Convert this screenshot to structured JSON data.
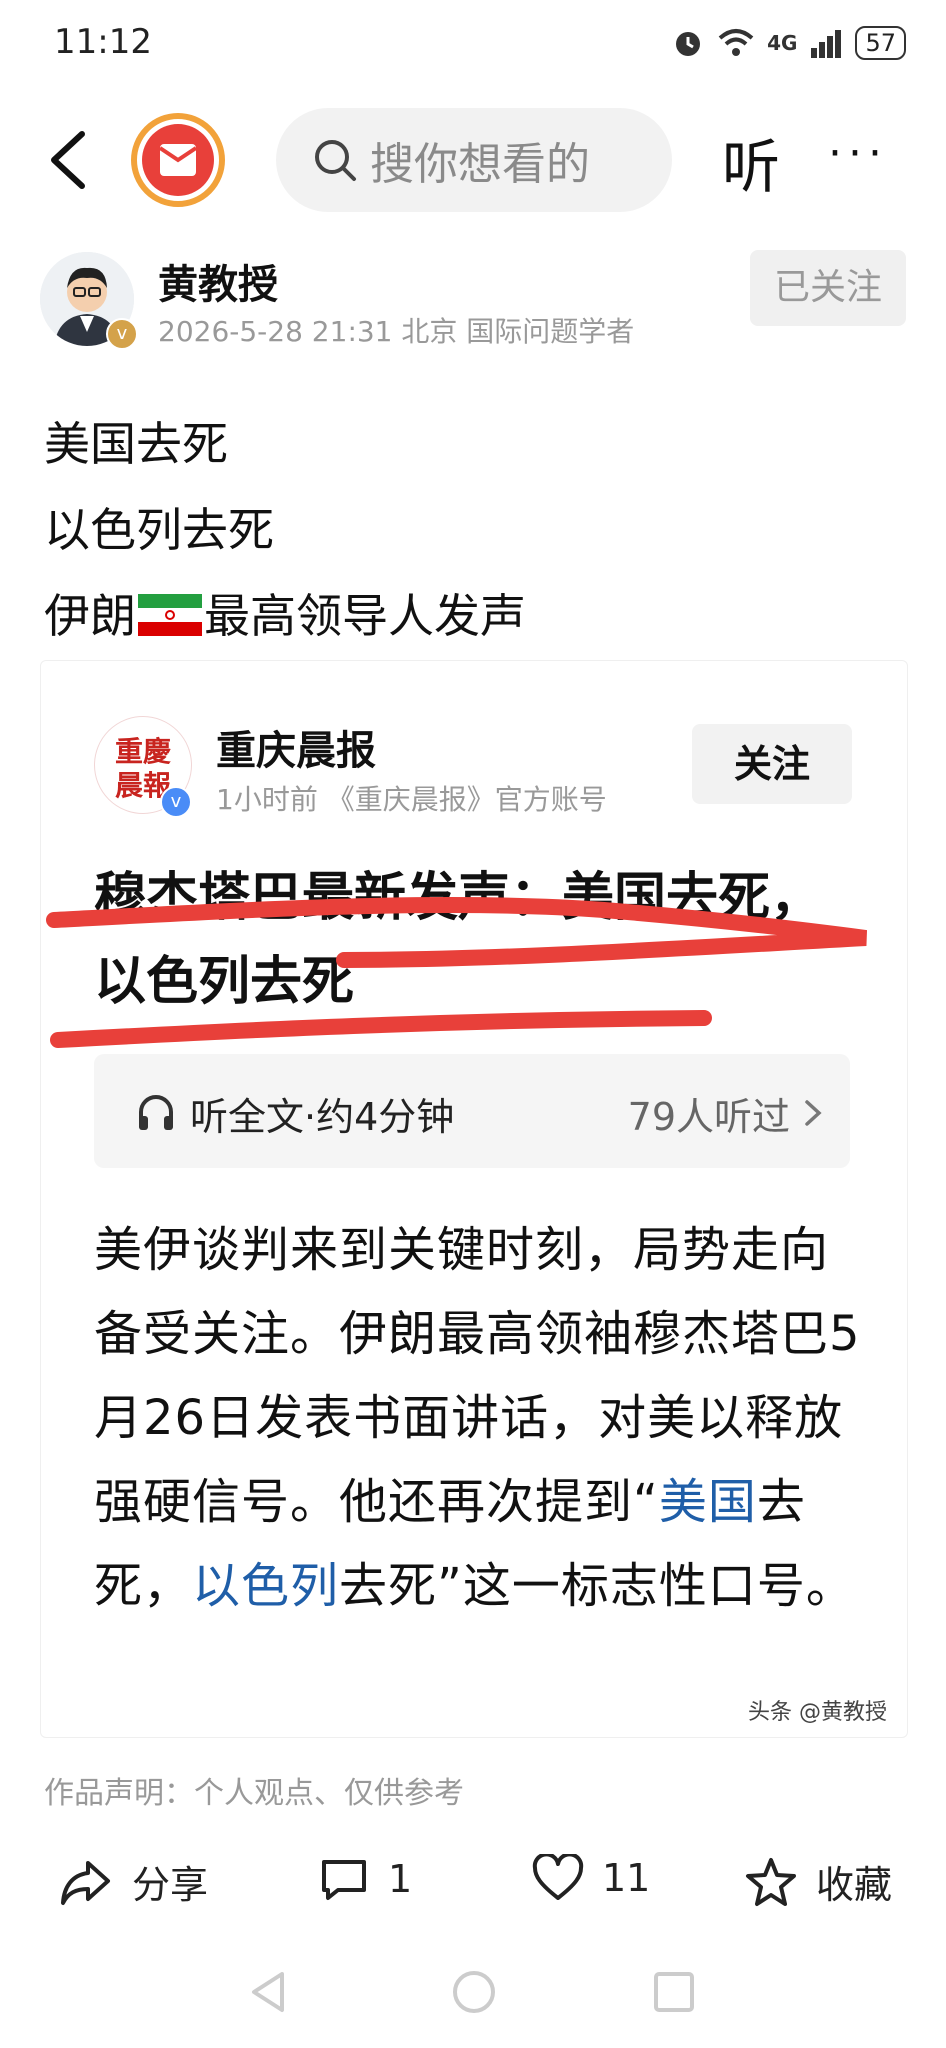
{
  "status_bar": {
    "time": "11:12",
    "network": "4G",
    "battery": "57"
  },
  "nav": {
    "search_placeholder": "搜你想看的",
    "listen_label": "听",
    "more_label": "···"
  },
  "author": {
    "name": "黄教授",
    "meta": "2026-5-28 21:31  北京  国际问题学者",
    "follow_state": "已关注",
    "verified_mark": "v"
  },
  "post": {
    "lines": [
      "美国去死",
      "以色列去死"
    ],
    "line3_before": "伊朗",
    "line3_after": "最高领导人发声"
  },
  "card": {
    "source_name": "重庆晨报",
    "source_logo_text": "重慶晨報",
    "source_meta": "1小时前  《重庆晨报》官方账号",
    "follow_label": "关注",
    "headline": "穆杰塔巴最新发声：美国去死，以色列去死",
    "audio_label": "听全文·约4分钟",
    "audio_count": "79人听过",
    "article_p1": "美伊谈判来到关键时刻，局势走向备受关注。伊朗最高领袖穆杰塔巴5月26日发表书面讲话，对美以释放强硬信号。他还再次提到“",
    "article_hl1": "美国",
    "article_p2": "去死，",
    "article_hl2": "以色列",
    "article_p3": "去死”这一标志性口号。",
    "watermark": "头条 @黄教授"
  },
  "disclaimer": "作品声明：个人观点、仅供参考",
  "actions": {
    "share": "分享",
    "comments": "1",
    "likes": "11",
    "collect": "收藏"
  },
  "colors": {
    "highlight_blue": "#1f5ea8",
    "underline_red": "#e8403a",
    "app_logo_red": "#e8403a",
    "verified_gold": "#d4a24a"
  }
}
